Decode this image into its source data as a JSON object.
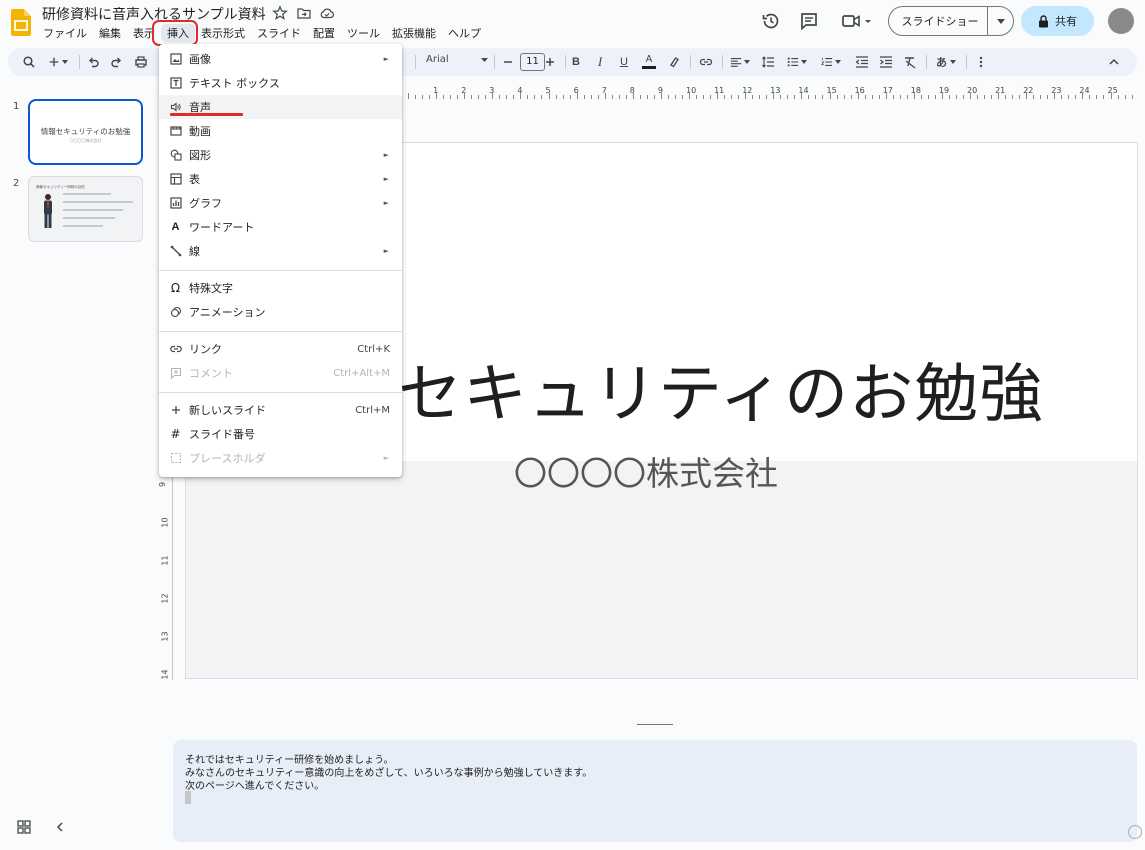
{
  "app": {
    "doc_title": "研修資料に音声入れるサンプル資料",
    "logo_icon": "slides-logo-icon",
    "accent_color": "#0b57d0",
    "share_color": "#c2e7ff",
    "annotation_color": "#e02b2b"
  },
  "menu_bar": [
    {
      "label": "ファイル"
    },
    {
      "label": "編集"
    },
    {
      "label": "表示"
    },
    {
      "label": "挿入"
    },
    {
      "label": "表示形式"
    },
    {
      "label": "スライド"
    },
    {
      "label": "配置"
    },
    {
      "label": "ツール"
    },
    {
      "label": "拡張機能"
    },
    {
      "label": "ヘルプ"
    }
  ],
  "header": {
    "slideshow_label": "スライドショー",
    "share_label": "共有"
  },
  "toolbar": {
    "font": "Arial",
    "font_size": "11",
    "ime_label": "あ"
  },
  "ruler": {
    "top_numbers": [
      "1",
      "2",
      "3",
      "4",
      "5",
      "6",
      "7",
      "8",
      "9",
      "10",
      "11",
      "12",
      "13",
      "14",
      "15",
      "16",
      "17",
      "18",
      "19",
      "20",
      "21",
      "22",
      "23",
      "24",
      "25"
    ],
    "left_numbers": [
      "9",
      "10",
      "11",
      "12",
      "13",
      "14"
    ]
  },
  "filmstrip": {
    "slides": [
      {
        "number": "1",
        "title": "情報セキュリティのお勉強",
        "subtitle": "〇〇〇〇株式会社"
      },
      {
        "number": "2",
        "title": "情報セキュリティー研修の目的"
      }
    ]
  },
  "slide": {
    "title": "情報セキュリティのお勉強",
    "title_visible": "セキュリティのお勉強",
    "subtitle": "〇〇〇〇株式会社"
  },
  "insert_menu": {
    "items": [
      {
        "label": "画像",
        "icon": "image-icon",
        "submenu": true
      },
      {
        "label": "テキスト ボックス",
        "icon": "text-box-icon"
      },
      {
        "label": "音声",
        "icon": "audio-icon",
        "highlighted": true
      },
      {
        "label": "動画",
        "icon": "video-icon"
      },
      {
        "label": "図形",
        "icon": "shapes-icon",
        "submenu": true
      },
      {
        "label": "表",
        "icon": "table-icon",
        "submenu": true
      },
      {
        "label": "グラフ",
        "icon": "chart-icon",
        "submenu": true
      },
      {
        "label": "ワードアート",
        "icon": "word-art-icon"
      },
      {
        "label": "線",
        "icon": "line-icon",
        "submenu": true
      },
      {
        "label": "特殊文字",
        "icon": "omega-icon"
      },
      {
        "label": "アニメーション",
        "icon": "animation-icon"
      },
      {
        "label": "リンク",
        "icon": "link-icon",
        "shortcut": "Ctrl+K"
      },
      {
        "label": "コメント",
        "icon": "comment-icon",
        "shortcut": "Ctrl+Alt+M",
        "disabled": true
      },
      {
        "label": "新しいスライド",
        "icon": "plus-icon",
        "shortcut": "Ctrl+M"
      },
      {
        "label": "スライド番号",
        "icon": "hash-icon"
      },
      {
        "label": "プレースホルダ",
        "icon": "placeholder-icon",
        "submenu": true,
        "disabled": true
      }
    ]
  },
  "notes": {
    "lines": [
      "それではセキュリティー研修を始めましょう。",
      "みなさんのセキュリティー意識の向上をめざして、いろいろな事例から勉強していきます。",
      "次のページへ進んでください。"
    ]
  }
}
